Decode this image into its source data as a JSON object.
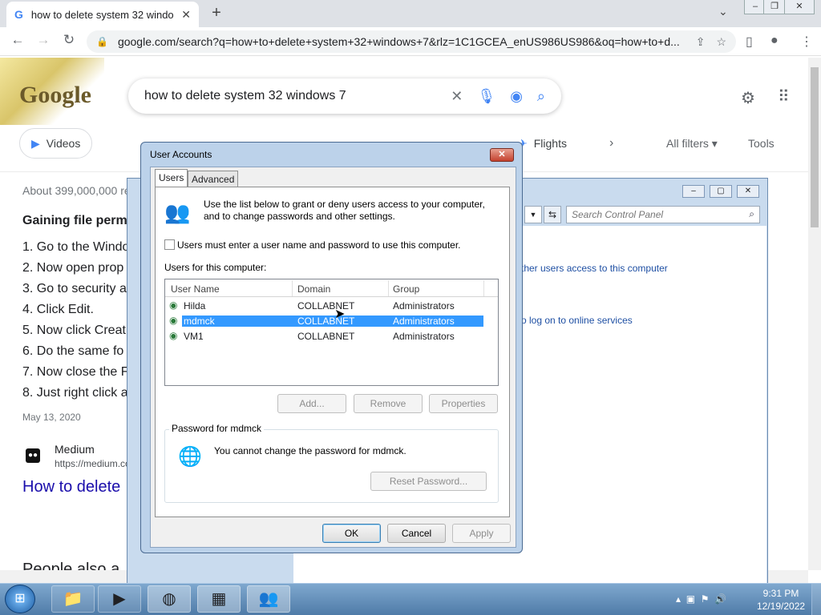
{
  "browser": {
    "tab_title": "how to delete system 32 windo",
    "new_tab": "+",
    "url": "google.com/search?q=how+to+delete+system+32+windows+7&rlz=1C1GCEA_enUS986US986&oq=how+to+d..."
  },
  "google": {
    "logo": "Google",
    "query": "how to delete system 32 windows 7",
    "chips": {
      "videos": "Videos",
      "flights": "Flights"
    },
    "all_filters": "All filters",
    "tools": "Tools",
    "about": "About 399,000,000 re",
    "snippet_title": "Gaining file perm",
    "steps": [
      "1. Go to the Windo",
      "2. Now open prop",
      "3. Go to security a",
      "4. Click Edit.",
      "5. Now click Creat",
      "6. Do the same fo",
      "7. Now close the F",
      "8. Just right click a"
    ],
    "date": "May 13, 2020",
    "source_name": "Medium",
    "source_url": "https://medium.co",
    "result_link": "How to delete",
    "people_also": "People also a"
  },
  "control_panel": {
    "search_placeholder": "Search Control Panel",
    "link_users_access": "ther users access to this computer",
    "link_online": "o log on to online services"
  },
  "dialog": {
    "title": "User Accounts",
    "tabs": [
      "Users",
      "Advanced"
    ],
    "intro": "Use the list below to grant or deny users access to your computer, and to change passwords and other settings.",
    "checkbox_label": "Users must enter a user name and password to use this computer.",
    "checkbox_checked": false,
    "users_for_label": "Users for this computer:",
    "columns": [
      "User Name",
      "Domain",
      "Group"
    ],
    "rows": [
      {
        "name": "Hilda",
        "domain": "COLLABNET",
        "group": "Administrators"
      },
      {
        "name": "mdmck",
        "domain": "COLLABNET",
        "group": "Administrators",
        "selected": true
      },
      {
        "name": "VM1",
        "domain": "COLLABNET",
        "group": "Administrators"
      }
    ],
    "buttons": {
      "add": "Add...",
      "remove": "Remove",
      "properties": "Properties",
      "reset": "Reset Password...",
      "ok": "OK",
      "cancel": "Cancel",
      "apply": "Apply"
    },
    "password_group": "Password for mdmck",
    "password_msg": "You cannot change the password for mdmck."
  },
  "taskbar": {
    "time": "9:31 PM",
    "date": "12/19/2022"
  }
}
